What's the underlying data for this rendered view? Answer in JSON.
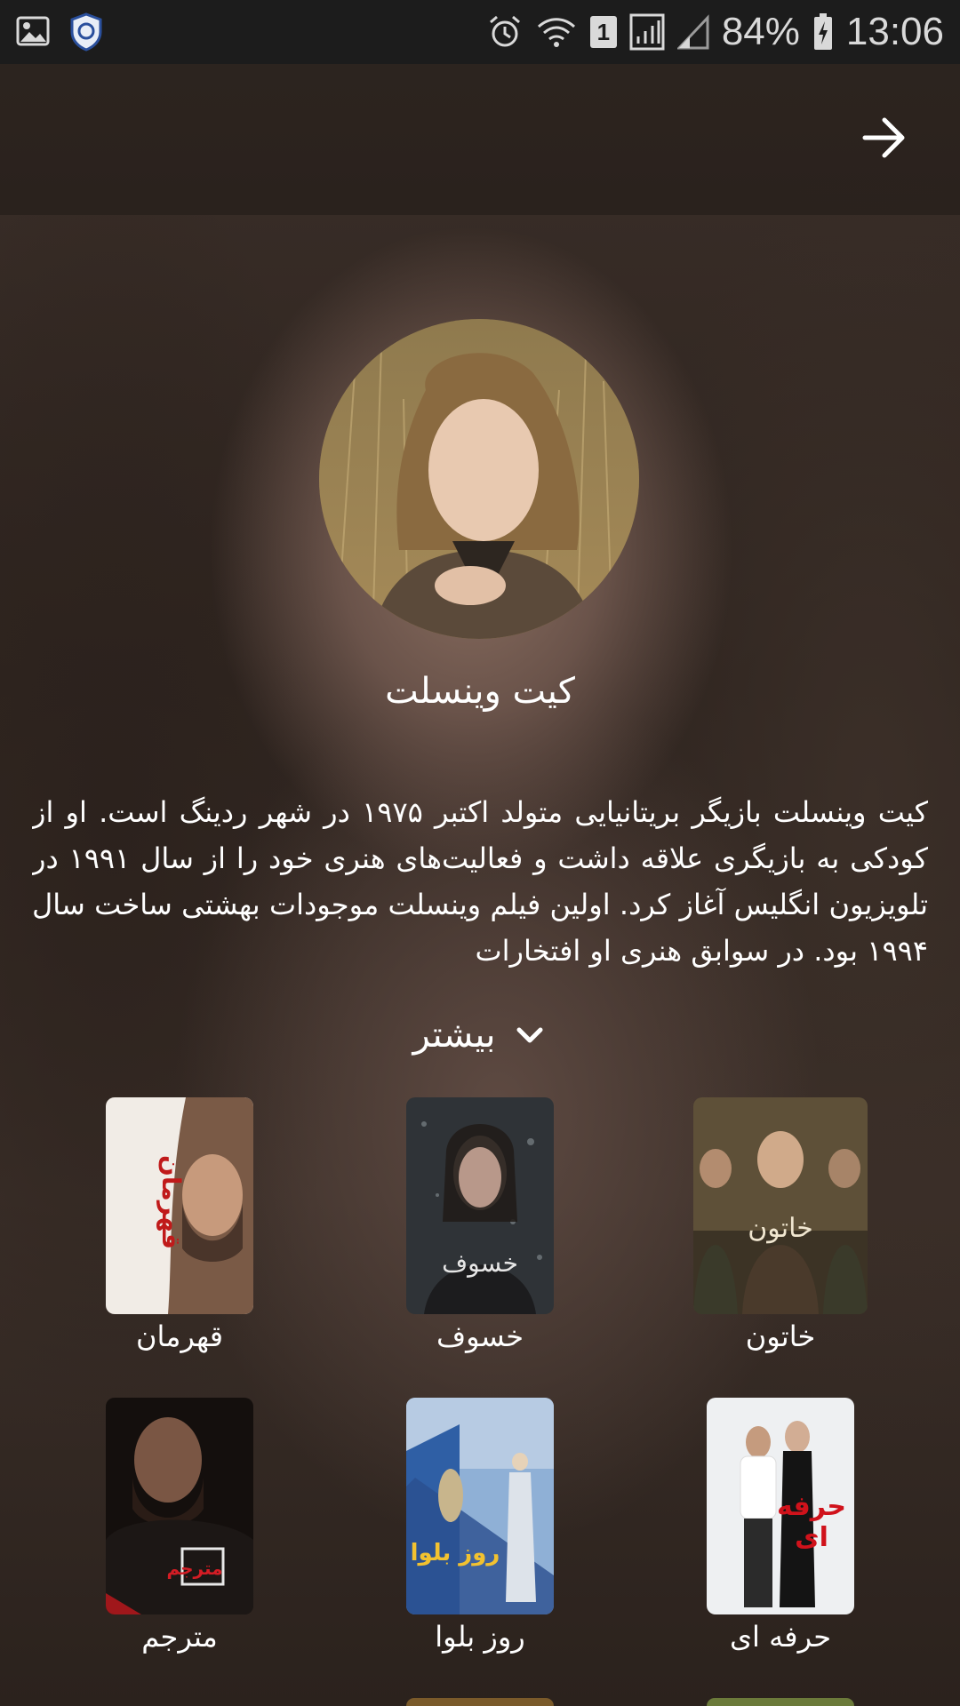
{
  "status_bar": {
    "battery": "84%",
    "time": "13:06",
    "sim_badge": "1",
    "icons": [
      "gallery-icon",
      "security-app-icon",
      "alarm-icon",
      "wifi-icon",
      "sim-icon",
      "signal-icon",
      "battery-charging-icon"
    ]
  },
  "header": {
    "back_icon": "arrow-right-icon"
  },
  "profile": {
    "name": "کیت وینسلت",
    "bio": "کیت وینسلت بازیگر بریتانیایی متولد اکتبر ۱۹۷۵ در شهر ردینگ است. او از کودکی به بازیگری علاقه داشت و فعالیت‌های هنری خود را از سال ۱۹۹۱ در تلویزیون انگلیس آغاز کرد. اولین فیلم وینسلت موجودات بهشتی ساخت سال ۱۹۹۴ بود. در سوابق هنری او افتخارات"
  },
  "more": {
    "label": "بیشتر",
    "icon": "chevron-down-icon"
  },
  "films": [
    {
      "title": "خاتون",
      "poster_text": "خاتون"
    },
    {
      "title": "خسوف",
      "poster_text": "خسوف"
    },
    {
      "title": "قهرمان",
      "poster_text": "قهرمان"
    },
    {
      "title": "حرفه ای",
      "poster_text": "حرفه ای"
    },
    {
      "title": "روز بلوا",
      "poster_text": "روز بلوا"
    },
    {
      "title": "مترجم",
      "poster_text": "مترجم"
    }
  ],
  "colors": {
    "text": "#ffffff",
    "statusbar": "#1c1c1c"
  }
}
